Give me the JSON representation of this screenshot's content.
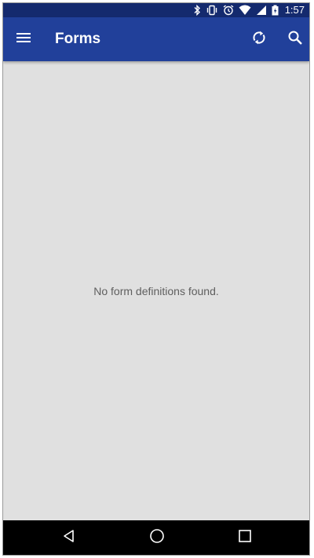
{
  "status_bar": {
    "time": "1:57",
    "icons": [
      "bluetooth-icon",
      "vibrate-icon",
      "alarm-icon",
      "wifi-icon",
      "signal-icon",
      "battery-icon"
    ]
  },
  "app_bar": {
    "title": "Forms",
    "left_icon": "menu-icon",
    "right_icons": [
      "sync-icon",
      "search-icon"
    ],
    "background_color": "#21409a"
  },
  "content": {
    "empty_message": "No form definitions found.",
    "background_color": "#e0e0e0"
  },
  "navigation_bar": {
    "buttons": [
      "back-icon",
      "home-icon",
      "recents-icon"
    ]
  }
}
